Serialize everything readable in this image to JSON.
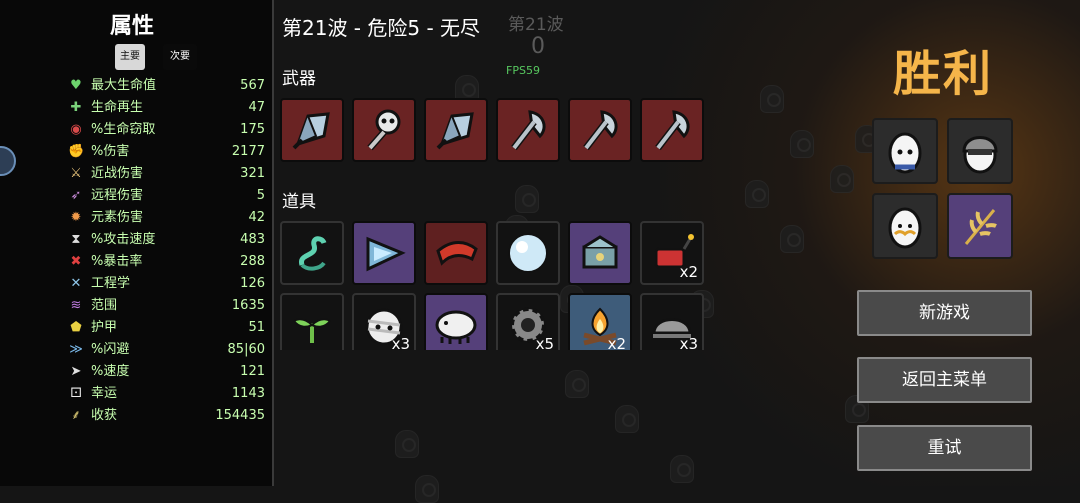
{
  "stats": {
    "title": "属性",
    "tab_primary": "主要",
    "tab_secondary": "次要",
    "rows": [
      {
        "icon": "heart-icon",
        "glyph": "♥",
        "color": "#6cd46c",
        "label": "最大生命值",
        "value": "567"
      },
      {
        "icon": "regen-icon",
        "glyph": "✚",
        "color": "#7ad17a",
        "label": "生命再生",
        "value": "47"
      },
      {
        "icon": "lifesteal-icon",
        "glyph": "◉",
        "color": "#d84a4a",
        "label": "%生命窃取",
        "value": "175"
      },
      {
        "icon": "damage-icon",
        "glyph": "✊",
        "color": "#e05a5a",
        "label": "%伤害",
        "value": "2177"
      },
      {
        "icon": "melee-icon",
        "glyph": "⚔",
        "color": "#e7c37a",
        "label": "近战伤害",
        "value": "321"
      },
      {
        "icon": "ranged-icon",
        "glyph": "➶",
        "color": "#c78ad8",
        "label": "远程伤害",
        "value": "5"
      },
      {
        "icon": "elemental-icon",
        "glyph": "✹",
        "color": "#f09a4a",
        "label": "元素伤害",
        "value": "42"
      },
      {
        "icon": "hourglass-icon",
        "glyph": "⧗",
        "color": "#dddddd",
        "label": "%攻击速度",
        "value": "483"
      },
      {
        "icon": "crit-icon",
        "glyph": "✖",
        "color": "#e04040",
        "label": "%暴击率",
        "value": "288"
      },
      {
        "icon": "engineering-icon",
        "glyph": "✕",
        "color": "#8fc7ea",
        "label": "工程学",
        "value": "126"
      },
      {
        "icon": "range-icon",
        "glyph": "≋",
        "color": "#c07be0",
        "label": "范围",
        "value": "1635"
      },
      {
        "icon": "armor-icon",
        "glyph": "⬟",
        "color": "#e9d042",
        "label": "护甲",
        "value": "51"
      },
      {
        "icon": "dodge-icon",
        "glyph": "≫",
        "color": "#7ab8e8",
        "label": "%闪避",
        "value": "85|60"
      },
      {
        "icon": "speed-icon",
        "glyph": "➤",
        "color": "#e0e0e0",
        "label": "%速度",
        "value": "121"
      },
      {
        "icon": "luck-icon",
        "glyph": "⚀",
        "color": "#eeeeee",
        "label": "幸运",
        "value": "1143"
      },
      {
        "icon": "harvest-icon",
        "glyph": "⸙",
        "color": "#e6d37a",
        "label": "收获",
        "value": "154435"
      }
    ]
  },
  "center": {
    "wave_title": "第21波 - 危险5 - 无尽",
    "ghost_wave": "第21波",
    "ghost_counter": "0",
    "fps": "FPS59",
    "weapons_label": "武器",
    "items_label": "道具",
    "weapons": [
      {
        "icon": "crystal-shard-icon"
      },
      {
        "icon": "skull-staff-icon"
      },
      {
        "icon": "crystal-shard-icon"
      },
      {
        "icon": "axe-icon"
      },
      {
        "icon": "axe-icon"
      },
      {
        "icon": "axe-icon"
      }
    ],
    "items_row1": [
      {
        "icon": "tentacle-icon",
        "style": "item-black",
        "qty": ""
      },
      {
        "icon": "triangle-gem-icon",
        "style": "item-purple",
        "qty": ""
      },
      {
        "icon": "bandana-icon",
        "style": "item-red",
        "qty": ""
      },
      {
        "icon": "snowball-icon",
        "style": "item-black",
        "qty": ""
      },
      {
        "icon": "treasure-pile-icon",
        "style": "item-purple",
        "qty": ""
      },
      {
        "icon": "dynamite-icon",
        "style": "item-black",
        "qty": "x2"
      }
    ],
    "items_row2": [
      {
        "icon": "sprout-icon",
        "style": "item-black",
        "qty": ""
      },
      {
        "icon": "bandaged-head-icon",
        "style": "item-black",
        "qty": "x3"
      },
      {
        "icon": "tardigrade-icon",
        "style": "item-purple",
        "qty": ""
      },
      {
        "icon": "gear-icon",
        "style": "item-black",
        "qty": "x5"
      },
      {
        "icon": "campfire-icon",
        "style": "item-blue",
        "qty": "x2"
      },
      {
        "icon": "helmet-icon",
        "style": "item-black",
        "qty": "x3"
      }
    ]
  },
  "right": {
    "victory": "胜利",
    "characters": [
      {
        "icon": "egg-character-icon",
        "style": ""
      },
      {
        "icon": "helmet-egg-character-icon",
        "style": ""
      },
      {
        "icon": "mustache-egg-character-icon",
        "style": ""
      },
      {
        "icon": "wheat-icon",
        "style": "purple"
      }
    ],
    "buttons": {
      "new_game": "新游戏",
      "main_menu": "返回主菜单",
      "retry": "重试"
    }
  }
}
